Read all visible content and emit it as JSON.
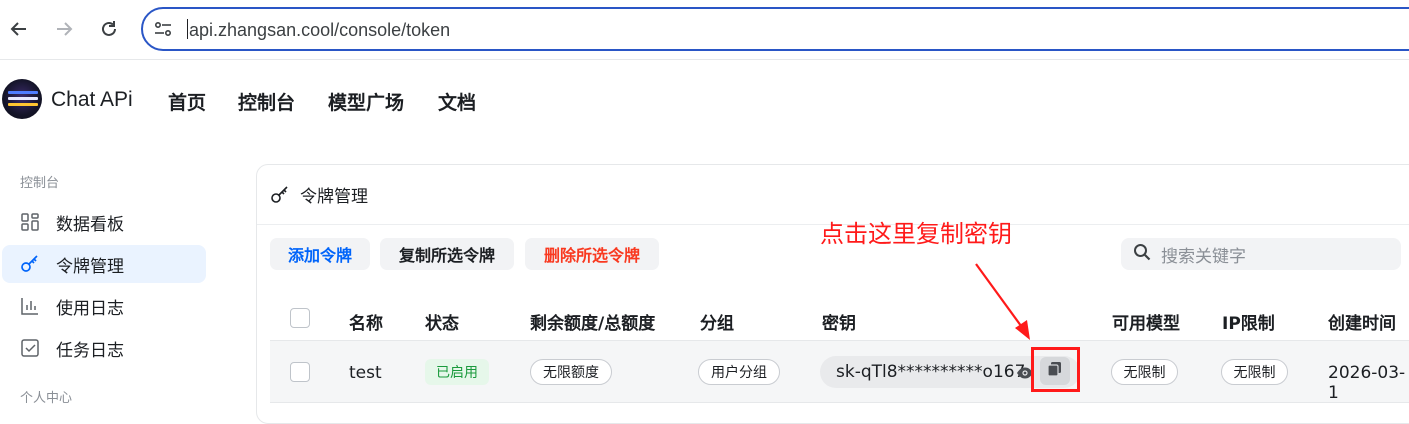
{
  "browser": {
    "url": "api.zhangsan.cool/console/token"
  },
  "header": {
    "brand": "Chat APi",
    "nav": [
      "首页",
      "控制台",
      "模型广场",
      "文档"
    ]
  },
  "sidebar": {
    "group1": "控制台",
    "items": [
      {
        "label": "数据看板",
        "icon": "dashboard-icon"
      },
      {
        "label": "令牌管理",
        "icon": "key-icon",
        "active": true
      },
      {
        "label": "使用日志",
        "icon": "bar-chart-icon"
      },
      {
        "label": "任务日志",
        "icon": "checkbox-icon"
      }
    ],
    "group2": "个人中心"
  },
  "page": {
    "title": "令牌管理",
    "buttons": {
      "add": "添加令牌",
      "copy": "复制所选令牌",
      "delete": "删除所选令牌"
    },
    "search_placeholder": "搜索关键字",
    "annotation": "点击这里复制密钥"
  },
  "table": {
    "headers": [
      "名称",
      "状态",
      "剩余额度/总额度",
      "分组",
      "密钥",
      "可用模型",
      "IP限制",
      "创建时间"
    ],
    "rows": [
      {
        "name": "test",
        "status": "已启用",
        "quota": "无限额度",
        "group": "用户分组",
        "key": "sk-qTl8**********o167",
        "models": "无限制",
        "ip": "无限制",
        "created": "2026-03-1"
      }
    ]
  },
  "colors": {
    "accent": "#0064fa",
    "danger": "#f93920",
    "annotation": "#ff1a1a",
    "status_green": "#1a9a3c",
    "active_bg": "#eaf3ff"
  }
}
